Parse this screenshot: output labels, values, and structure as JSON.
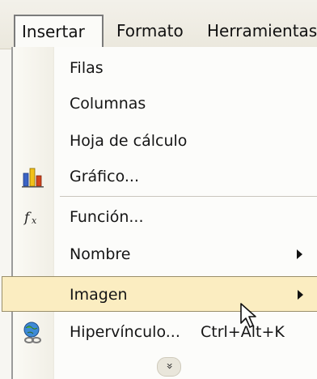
{
  "menubar": {
    "insertar": "Insertar",
    "formato": "Formato",
    "herramientas": "Herramientas"
  },
  "menu": {
    "filas": "Filas",
    "columnas": "Columnas",
    "hoja": "Hoja de cálculo",
    "grafico": "Gráfico...",
    "funcion": "Función...",
    "nombre": "Nombre",
    "imagen": "Imagen",
    "hipervinculo": "Hipervínculo...",
    "hipervinculo_shortcut": "Ctrl+Alt+K",
    "expand": "»"
  },
  "icons": {
    "chart": "bar-chart-icon",
    "function": "function-fx-icon",
    "hyperlink": "globe-link-icon"
  },
  "colors": {
    "highlight": "#fbedc1",
    "highlight_border": "#9a8f6b"
  }
}
